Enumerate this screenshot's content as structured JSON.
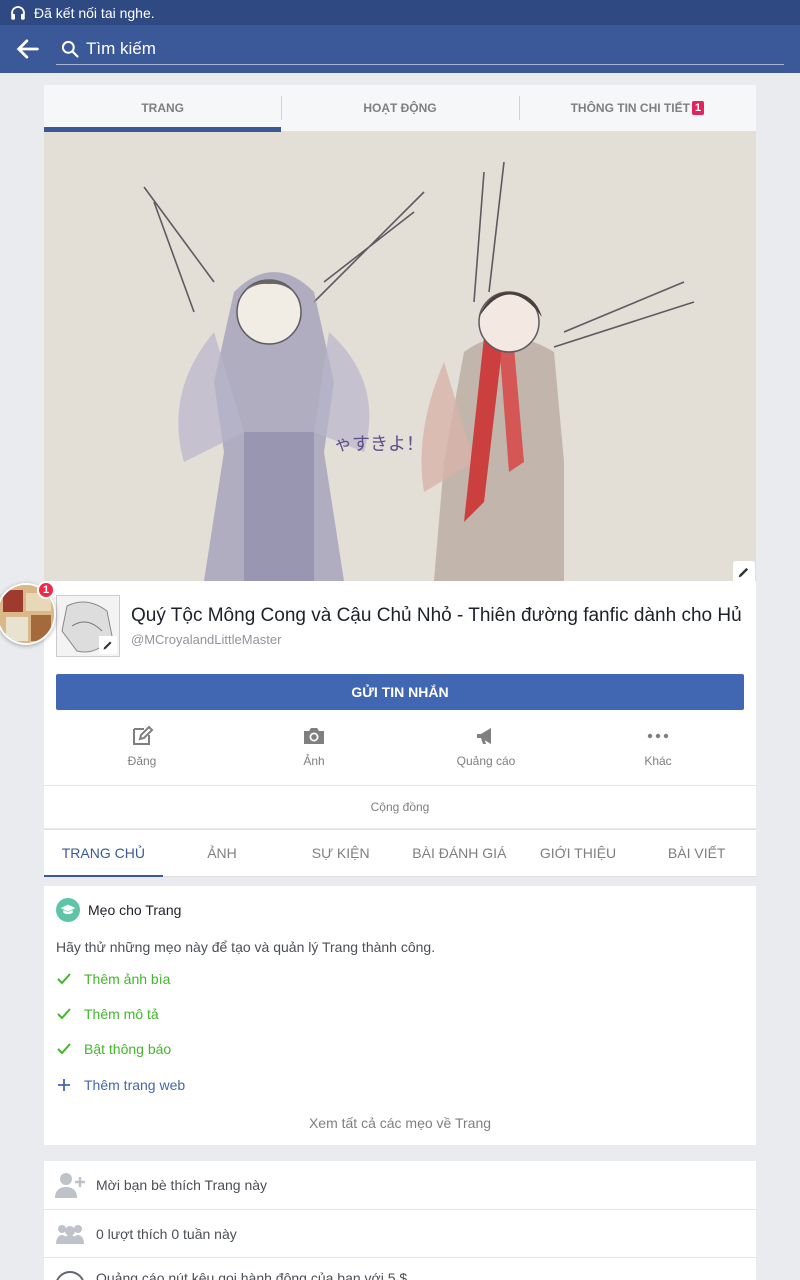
{
  "status_bar": {
    "text": "Đã kết nối tai nghe."
  },
  "search": {
    "placeholder": "Tìm kiếm"
  },
  "top_tabs": [
    {
      "label": "TRANG",
      "active": true
    },
    {
      "label": "HOẠT ĐỘNG",
      "active": false
    },
    {
      "label": "THÔNG TIN CHI TIẾT",
      "active": false,
      "badge": "1"
    }
  ],
  "cover": {
    "caption": "ゃすきよ！"
  },
  "chat_head": {
    "badge": "1"
  },
  "page": {
    "name": "Quý Tộc Mông Cong và Cậu Chủ Nhỏ - Thiên đường fanfic dành cho Hủ",
    "handle": "@MCroyalandLittleMaster",
    "message_button": "GỬI TIN NHẮN",
    "community": "Cộng đồng"
  },
  "actions": [
    {
      "label": "Đăng",
      "icon": "edit-icon"
    },
    {
      "label": "Ảnh",
      "icon": "camera-icon"
    },
    {
      "label": "Quảng cáo",
      "icon": "megaphone-icon"
    },
    {
      "label": "Khác",
      "icon": "more-icon"
    }
  ],
  "nav_tabs": [
    {
      "label": "TRANG CHỦ",
      "active": true
    },
    {
      "label": "ẢNH",
      "active": false
    },
    {
      "label": "SỰ KIỆN",
      "active": false
    },
    {
      "label": "BÀI ĐÁNH GIÁ",
      "active": false
    },
    {
      "label": "GIỚI THIỆU",
      "active": false
    },
    {
      "label": "BÀI VIẾT",
      "active": false
    }
  ],
  "tips": {
    "title": "Mẹo cho Trang",
    "description": "Hãy thử những mẹo này để tạo và quản lý Trang thành công.",
    "items": [
      {
        "label": "Thêm ảnh bìa",
        "done": true
      },
      {
        "label": "Thêm mô tả",
        "done": true
      },
      {
        "label": "Bật thông báo",
        "done": true
      },
      {
        "label": "Thêm trang web",
        "done": false
      }
    ],
    "see_all": "Xem tất cả các mẹo về Trang"
  },
  "bottom_rows": [
    {
      "label": "Mời bạn bè thích Trang này",
      "icon": "add-friend-icon"
    },
    {
      "label": "0 lượt thích 0 tuần này",
      "icon": "people-icon"
    },
    {
      "label": "Quảng cáo nút kêu gọi hành động của bạn với 5 $",
      "icon": "play-icon"
    }
  ],
  "colors": {
    "brand": "#3b5998",
    "button": "#4267b2",
    "success": "#42b72a",
    "badge": "#e0245e"
  }
}
